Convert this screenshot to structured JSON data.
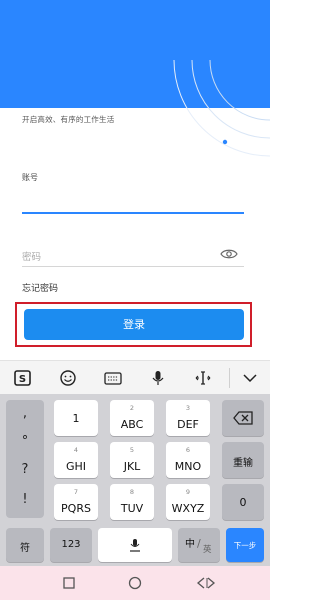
{
  "colors": {
    "brand": "#2a86ff",
    "login_button": "#1c8cf0",
    "highlight": "#d01e2a"
  },
  "header": {
    "slogan": "开启高效、有序的工作生活"
  },
  "form": {
    "account_label": "账号",
    "password_placeholder": "密码",
    "forgot_password": "忘记密码",
    "login_button": "登录"
  },
  "keyboard": {
    "toolbar_icons": [
      "sogou-logo-icon",
      "emoji-icon",
      "keyboard-icon",
      "microphone-icon",
      "cursor-move-icon",
      "collapse-chevron-icon"
    ],
    "symbols": [
      ",",
      "°",
      "?",
      "!"
    ],
    "keys": [
      {
        "num": "1",
        "main": "1"
      },
      {
        "num": "2",
        "main": "ABC"
      },
      {
        "num": "3",
        "main": "DEF"
      },
      {
        "num": "4",
        "main": "GHI"
      },
      {
        "num": "5",
        "main": "JKL"
      },
      {
        "num": "6",
        "main": "MNO"
      },
      {
        "num": "7",
        "main": "PQRS"
      },
      {
        "num": "8",
        "main": "TUV"
      },
      {
        "num": "9",
        "main": "WXYZ"
      }
    ],
    "reenter": "重输",
    "zero": "0",
    "bottom": {
      "symbols": "符",
      "num123": "123",
      "zh": "中",
      "en": "英",
      "next": "下一步"
    }
  }
}
